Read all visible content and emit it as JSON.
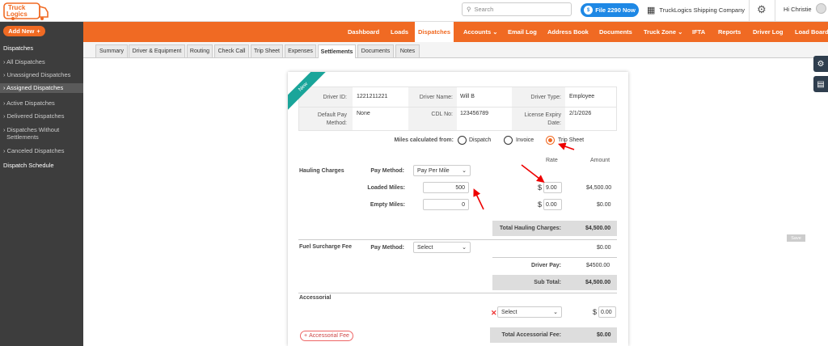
{
  "brand": {
    "logo_text_1": "Truck",
    "logo_text_2": "Logics",
    "accent_color": "#f06a23"
  },
  "topbar": {
    "search_placeholder": "Search",
    "file_button": "File 2290 Now",
    "company": "TruckLogics Shipping Company",
    "greeting": "Hi Christie"
  },
  "sidebar": {
    "add_new": "Add New",
    "section": "Dispatches",
    "items": [
      {
        "label": "All Dispatches"
      },
      {
        "label": "Unassigned Dispatches"
      },
      {
        "label": "Assigned Dispatches"
      },
      {
        "label": "Active Dispatches"
      },
      {
        "label": "Delivered Dispatches"
      },
      {
        "label": "Dispatches Without"
      },
      {
        "label": "Settlements"
      },
      {
        "label": "Canceled Dispatches"
      }
    ],
    "schedule": "Dispatch Schedule"
  },
  "nav": [
    "Dashboard",
    "Loads",
    "Dispatches",
    "Accounts",
    "Email Log",
    "Address Book",
    "Documents",
    "Truck Zone",
    "IFTA",
    "Reports",
    "Driver Log",
    "Load Board"
  ],
  "subtabs": [
    "Summary",
    "Driver & Equipment",
    "Routing",
    "Check Call",
    "Trip Sheet",
    "Expenses",
    "Settlements",
    "Documents",
    "Notes"
  ],
  "ribbon": "New",
  "driver": {
    "id_label": "Driver ID:",
    "id": "1221211221",
    "name_label": "Driver Name:",
    "name": "Will B",
    "type_label": "Driver Type:",
    "type": "Employee",
    "pay_label_1": "Default Pay",
    "pay_label_2": "Method:",
    "pay": "None",
    "cdl_label": "CDL No:",
    "cdl": "123456789",
    "exp_label_1": "License Expiry",
    "exp_label_2": "Date:",
    "exp": "2/1/2026"
  },
  "miles": {
    "label": "Miles calculated from:",
    "options": [
      "Dispatch",
      "Invoice",
      "Trip Sheet"
    ],
    "selected": "Trip Sheet"
  },
  "hauling": {
    "rate_header": "Rate",
    "amount_header": "Amount",
    "section": "Hauling Charges",
    "pay_method_label": "Pay Method:",
    "pay_method": "Pay Per Mile",
    "loaded_label": "Loaded Miles:",
    "loaded": "500",
    "empty_label": "Empty Miles:",
    "empty": "0",
    "currency": "$",
    "loaded_rate": "9.00",
    "loaded_amount": "$4,500.00",
    "empty_rate": "0.00",
    "empty_amount": "$0.00",
    "total_label": "Total Hauling Charges:",
    "total": "$4,500.00"
  },
  "fuel": {
    "section": "Fuel Surcharge Fee",
    "pay_method_label": "Pay Method:",
    "pay_method": "Select",
    "amount": "$0.00"
  },
  "pay": {
    "driver_label": "Driver Pay:",
    "driver": "$4500.00",
    "subtotal_label": "Sub Total:",
    "subtotal": "$4,500.00"
  },
  "accessorial": {
    "section": "Accessorial",
    "select": "Select",
    "currency": "$",
    "rate": "0.00",
    "add_button": "Accessorial Fee",
    "total_label": "Total Accessorial Fee:",
    "total": "$0.00"
  },
  "save_tag": "Save"
}
